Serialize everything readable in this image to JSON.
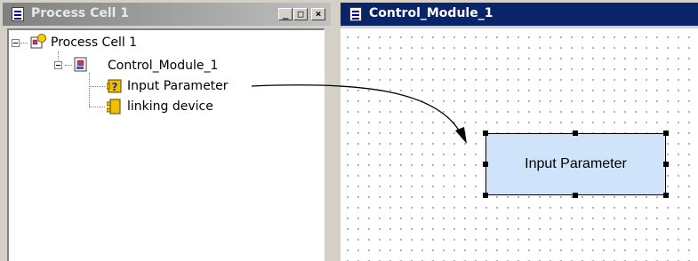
{
  "tree_window": {
    "title": "Process Cell 1",
    "buttons": {
      "minimize": "_",
      "maximize": "□",
      "close": "×"
    },
    "items": [
      {
        "label": "Process Cell 1",
        "icon": "process-cell-icon"
      },
      {
        "label": "Control_Module_1",
        "icon": "control-module-icon"
      },
      {
        "label": "Input Parameter",
        "icon": "input-parameter-icon"
      },
      {
        "label": "linking device",
        "icon": "linking-device-icon"
      }
    ]
  },
  "editor_window": {
    "title": "Control_Module_1",
    "block": {
      "label": "Input Parameter"
    }
  },
  "colors": {
    "active_title": "#0a246a",
    "inactive_title": "#808080",
    "block_fill": "#cfe3fb",
    "chrome": "#d4d0c8"
  }
}
